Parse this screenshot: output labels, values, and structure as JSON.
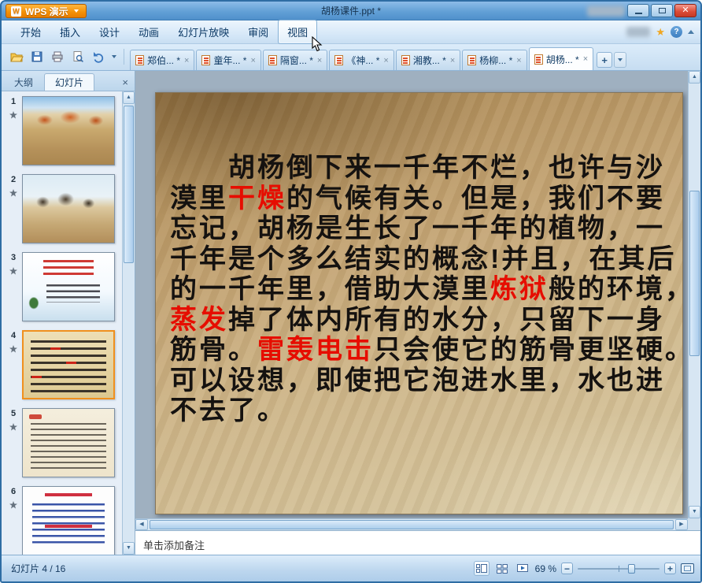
{
  "window": {
    "app_label": "WPS 演示",
    "title": "胡杨课件.ppt *"
  },
  "menu": {
    "items": [
      "开始",
      "插入",
      "设计",
      "动画",
      "幻灯片放映",
      "审阅",
      "视图"
    ],
    "active": "视图"
  },
  "toolbar": {
    "icons": [
      "open",
      "save",
      "print",
      "print-preview",
      "undo",
      "redo-dropdown"
    ]
  },
  "doc_tabs": {
    "tabs": [
      {
        "label": "郑伯... *"
      },
      {
        "label": "童年... *"
      },
      {
        "label": "隔窗... *"
      },
      {
        "label": "《神... *"
      },
      {
        "label": "湘教... *"
      },
      {
        "label": "杨柳... *"
      },
      {
        "label": "胡杨... *",
        "active": true
      }
    ],
    "new_tab_label": "+"
  },
  "sidebar": {
    "tabs": [
      {
        "label": "大纲"
      },
      {
        "label": "幻灯片",
        "active": true
      }
    ],
    "close_label": "×",
    "slides": [
      {
        "number": "1"
      },
      {
        "number": "2"
      },
      {
        "number": "3"
      },
      {
        "number": "4",
        "selected": true
      },
      {
        "number": "5"
      },
      {
        "number": "6"
      }
    ]
  },
  "slide": {
    "lines": [
      {
        "indent": true,
        "segments": [
          {
            "text": "胡杨倒下来一千年不烂，也许与沙",
            "color": "#151210"
          }
        ]
      },
      {
        "segments": [
          {
            "text": "漠里",
            "color": "#151210"
          },
          {
            "text": "干燥",
            "color": "#e60d00"
          },
          {
            "text": "的气候有关。但是，我们不要",
            "color": "#151210"
          }
        ]
      },
      {
        "segments": [
          {
            "text": "忘记，胡杨是生长了一千年的植物，一",
            "color": "#151210"
          }
        ]
      },
      {
        "segments": [
          {
            "text": "千年是个多么结实的概念!并且，在其后",
            "color": "#151210"
          }
        ]
      },
      {
        "segments": [
          {
            "text": "的一千年里，借助大漠里",
            "color": "#151210"
          },
          {
            "text": "炼狱",
            "color": "#e60d00"
          },
          {
            "text": "般的环境，",
            "color": "#151210"
          }
        ]
      },
      {
        "segments": [
          {
            "text": "蒸发",
            "color": "#e60d00"
          },
          {
            "text": "掉了体内所有的水分，只留下一身",
            "color": "#151210"
          }
        ]
      },
      {
        "segments": [
          {
            "text": "筋骨。",
            "color": "#151210"
          },
          {
            "text": "雷轰电击",
            "color": "#e60d00"
          },
          {
            "text": "只会使它的筋骨更坚硬。",
            "color": "#151210"
          }
        ]
      },
      {
        "segments": [
          {
            "text": "可以设想，即使把它泡进水里，水也进",
            "color": "#151210"
          }
        ]
      },
      {
        "segments": [
          {
            "text": "不去了。",
            "color": "#151210"
          }
        ]
      }
    ]
  },
  "notes": {
    "placeholder": "单击添加备注"
  },
  "status_bar": {
    "slide_indicator": "幻灯片 4 / 16",
    "zoom_label": "69 %",
    "view_buttons": [
      "normal-view",
      "slide-sorter",
      "slideshow"
    ]
  },
  "colors": {
    "highlight_red": "#e60d00",
    "selection_orange": "#f0901e",
    "chrome_blue": "#5e9bd2"
  }
}
